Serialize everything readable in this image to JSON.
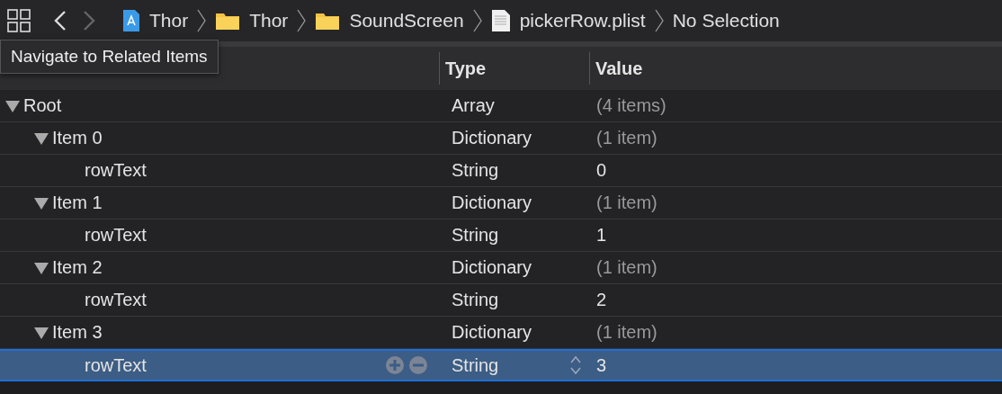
{
  "toolbar": {
    "breadcrumbs": [
      {
        "label": "Thor",
        "kind": "app"
      },
      {
        "label": "Thor",
        "kind": "folder"
      },
      {
        "label": "SoundScreen",
        "kind": "folder"
      },
      {
        "label": "pickerRow.plist",
        "kind": "plist"
      },
      {
        "label": "No Selection",
        "kind": "none"
      }
    ]
  },
  "tooltip": "Navigate to Related Items",
  "table": {
    "columns": [
      "Type",
      "Value"
    ],
    "rows": [
      {
        "key": "Root",
        "type": "Array",
        "value": "(4 items)",
        "expanded": true,
        "selected": false,
        "children": [
          {
            "key": "Item 0",
            "type": "Dictionary",
            "value": "(1 item)",
            "expanded": true,
            "selected": false,
            "children": [
              {
                "key": "rowText",
                "type": "String",
                "value": "0",
                "selected": false
              }
            ]
          },
          {
            "key": "Item 1",
            "type": "Dictionary",
            "value": "(1 item)",
            "expanded": true,
            "selected": false,
            "children": [
              {
                "key": "rowText",
                "type": "String",
                "value": "1",
                "selected": false
              }
            ]
          },
          {
            "key": "Item 2",
            "type": "Dictionary",
            "value": "(1 item)",
            "expanded": true,
            "selected": false,
            "children": [
              {
                "key": "rowText",
                "type": "String",
                "value": "2",
                "selected": false
              }
            ]
          },
          {
            "key": "Item 3",
            "type": "Dictionary",
            "value": "(1 item)",
            "expanded": true,
            "selected": false,
            "children": [
              {
                "key": "rowText",
                "type": "String",
                "value": "3",
                "selected": true
              }
            ]
          }
        ]
      }
    ]
  }
}
